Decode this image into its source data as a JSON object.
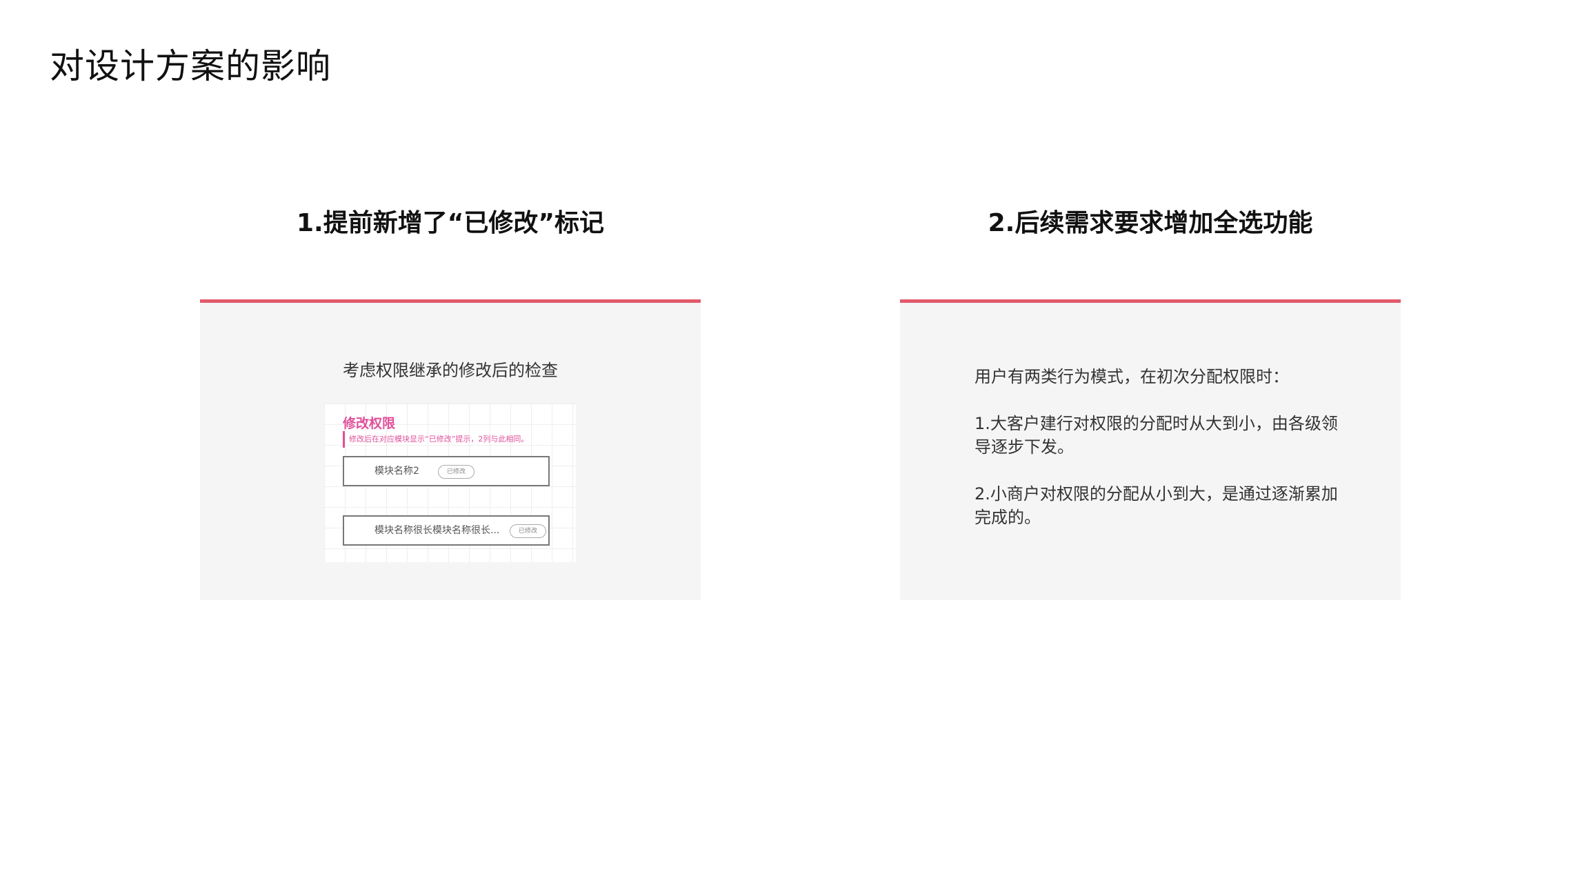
{
  "page": {
    "title": "对设计方案的影响"
  },
  "sections": [
    {
      "heading": "1.提前新增了“已修改”标记",
      "caption": "考虑权限继承的修改后的检查",
      "mock": {
        "title": "修改权限",
        "note": "修改后在对应模块显示“已修改”提示，2列与此相同。",
        "rows": [
          {
            "label": "模块名称2",
            "badge": "已修改"
          },
          {
            "label": "模块名称很长模块名称很长...",
            "badge": "已修改"
          }
        ]
      }
    },
    {
      "heading": "2.后续需求要求增加全选功能",
      "paragraphs": [
        "用户有两类行为模式，在初次分配权限时：",
        "1.大客户建行对权限的分配时从大到小，由各级领导逐步下发。",
        "2.小商户对权限的分配从小到大，是通过逐渐累加完成的。"
      ]
    }
  ],
  "colors": {
    "accent_bar": "#e25a6a",
    "mock_accent": "#e0509a",
    "card_background": "#f5f5f5"
  }
}
